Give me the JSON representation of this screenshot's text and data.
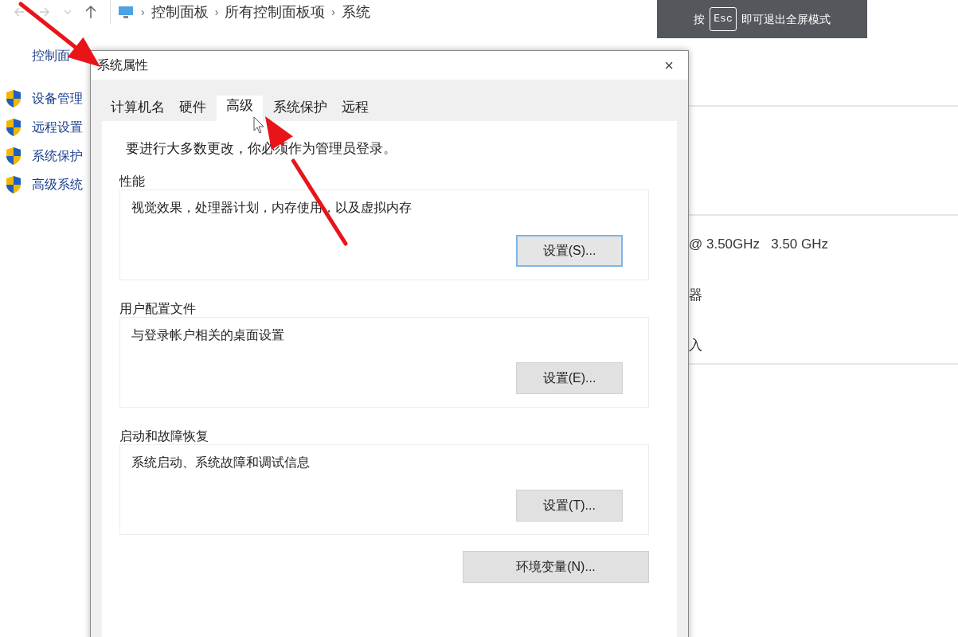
{
  "explorer": {
    "breadcrumb": [
      {
        "separator": "›",
        "label": "控制面板"
      },
      {
        "separator": "›",
        "label": "所有控制面板项"
      },
      {
        "separator": "›",
        "label": "系统"
      }
    ],
    "sidebar_title": "控制面",
    "sidebar_items": [
      "设备管理",
      "远程设置",
      "系统保护",
      "高级系统"
    ],
    "details": [
      {
        "text": "@ 3.50GHz   3.50 GHz"
      },
      {
        "text": "器"
      },
      {
        "text": "入"
      }
    ]
  },
  "fullscreen_hint": {
    "prefix": "按",
    "key": "Esc",
    "suffix": "即可退出全屏模式"
  },
  "dialog": {
    "title": "系统属性",
    "close": "×",
    "tabs": [
      {
        "label": "计算机名",
        "selected": false
      },
      {
        "label": "硬件",
        "selected": false
      },
      {
        "label": "高级",
        "selected": true
      },
      {
        "label": "系统保护",
        "selected": false
      },
      {
        "label": "远程",
        "selected": false
      }
    ],
    "notice": "要进行大多数更改，你必须作为管理员登录。",
    "groups": [
      {
        "title": "性能",
        "description": "视觉效果，处理器计划，内存使用，以及虚拟内存",
        "button": "设置(S)...",
        "focused": true
      },
      {
        "title": "用户配置文件",
        "description": "与登录帐户相关的桌面设置",
        "button": "设置(E)...",
        "focused": false
      },
      {
        "title": "启动和故障恢复",
        "description": "系统启动、系统故障和调试信息",
        "button": "设置(T)...",
        "focused": false
      }
    ],
    "env_button": "环境变量(N)..."
  }
}
